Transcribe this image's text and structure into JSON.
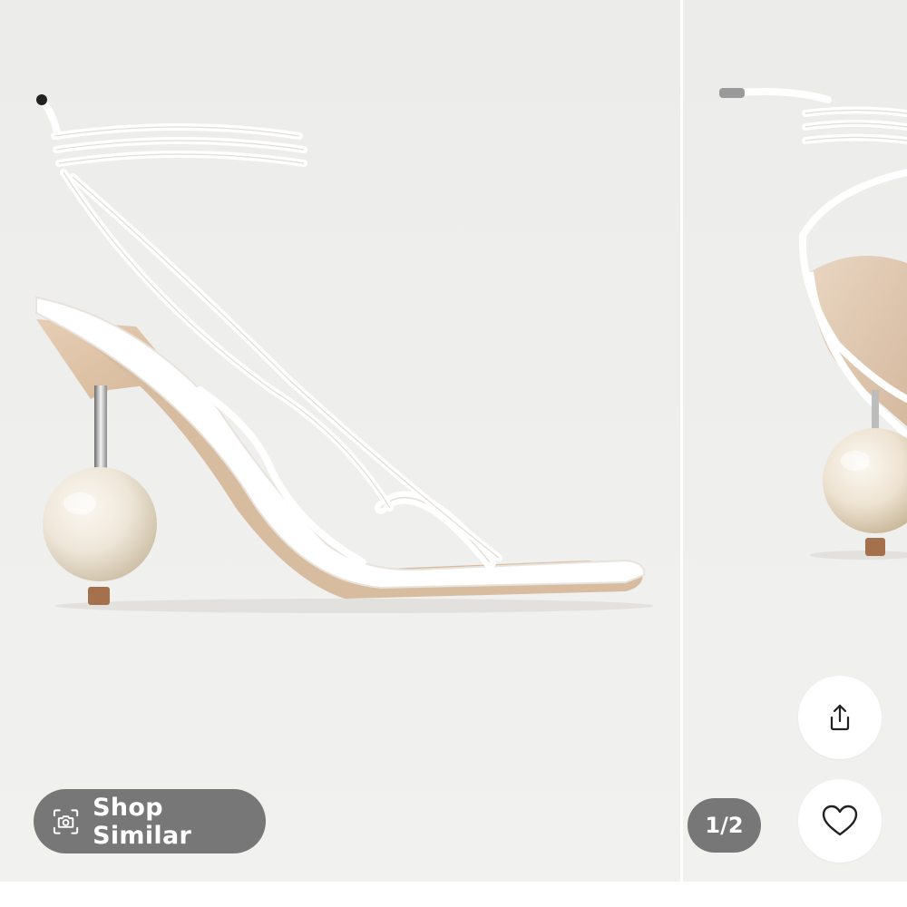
{
  "gallery": {
    "current_page": 1,
    "total_pages": 2,
    "page_indicator": "1/2"
  },
  "actions": {
    "shop_similar_label": "Shop Similar",
    "shop_similar_icon": "camera-scan-icon",
    "share_icon": "share-icon",
    "favorite_icon": "heart-icon"
  },
  "colors": {
    "background": "#eeeeec",
    "pill_overlay": "#6c6c6c",
    "button_white": "#ffffff",
    "icon": "#222222"
  }
}
